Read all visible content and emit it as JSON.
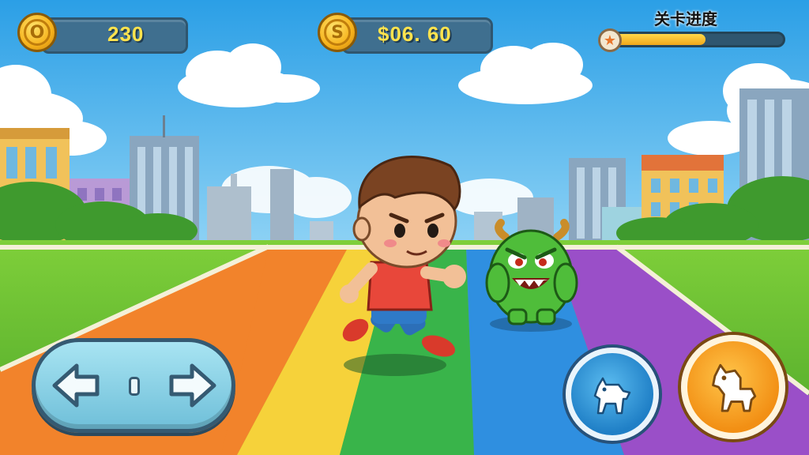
{
  "hud": {
    "coins": {
      "icon": "coin-icon",
      "symbol": "O",
      "value": "230"
    },
    "money": {
      "icon": "dollar-coin-icon",
      "symbol": "S",
      "value": "$06. 60"
    },
    "level_progress": {
      "title": "关卡进度",
      "fraction": 0.55,
      "icon": "star-icon"
    }
  },
  "controls": {
    "dpad": {
      "left_icon": "arrow-left-icon",
      "right_icon": "arrow-right-icon"
    },
    "action_primary": {
      "icon": "animal-icon",
      "color": "#1f7fc6"
    },
    "action_secondary": {
      "icon": "animal-icon",
      "color": "#f28f14"
    }
  },
  "scene": {
    "player": "running-boy",
    "enemy": "green-horned-monster",
    "track_colors": [
      "#f2832b",
      "#f6d23a",
      "#39b44a",
      "#2f8fe0",
      "#9a4fc8"
    ]
  }
}
